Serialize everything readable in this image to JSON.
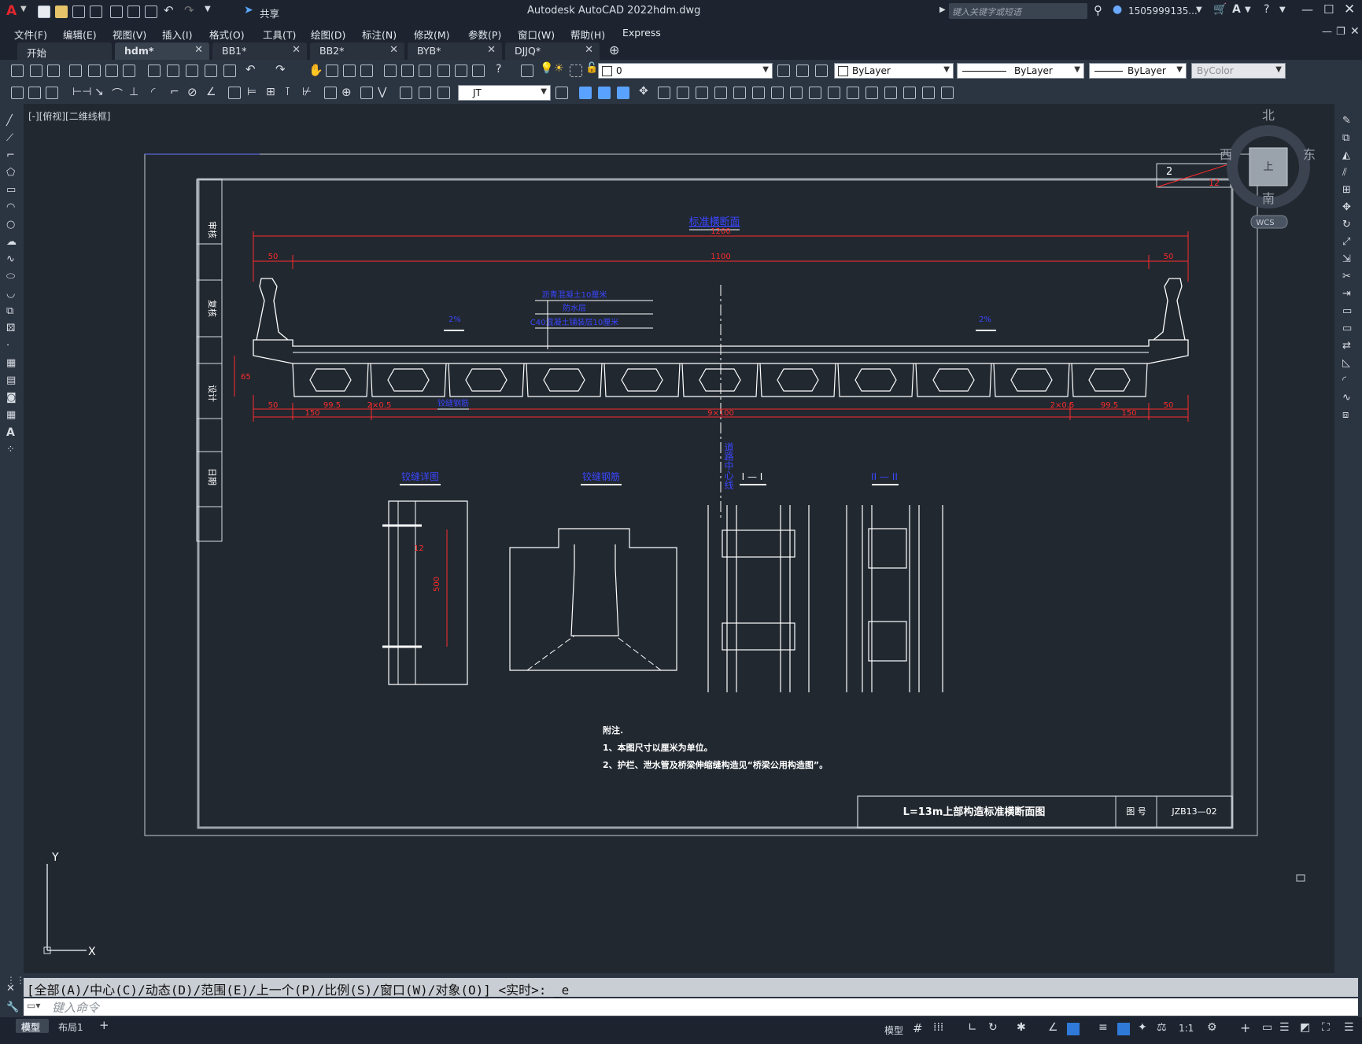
{
  "app": {
    "logo": "A",
    "title": "Autodesk AutoCAD 2022",
    "filename": "hdm.dwg",
    "share_label": "共享",
    "search_placeholder": "键入关键字或短语",
    "user": "1505999135...",
    "window_controls": [
      "minimize-icon",
      "restore-icon",
      "close-icon"
    ]
  },
  "menu": [
    "文件(F)",
    "编辑(E)",
    "视图(V)",
    "插入(I)",
    "格式(O)",
    "工具(T)",
    "绘图(D)",
    "标注(N)",
    "修改(M)",
    "参数(P)",
    "窗口(W)",
    "帮助(H)",
    "Express"
  ],
  "tabs": [
    {
      "label": "开始",
      "active": false
    },
    {
      "label": "hdm*",
      "active": true
    },
    {
      "label": "BB1*",
      "active": false
    },
    {
      "label": "BB2*",
      "active": false
    },
    {
      "label": "BYB*",
      "active": false
    },
    {
      "label": "DJJQ*",
      "active": false
    }
  ],
  "toolbar": {
    "layer_value": "0",
    "color_value": "ByLayer",
    "linetype_value": "ByLayer",
    "lineweight_value": "ByLayer",
    "plotstyle_value": "ByColor",
    "dimstyle_value": "JT"
  },
  "viewport": {
    "label": "[-][俯视][二维线框]",
    "compass": {
      "north": "北",
      "south": "南",
      "east": "东",
      "west": "西",
      "top": "上"
    },
    "wcs": "WCS",
    "ucs_x": "X",
    "ucs_y": "Y"
  },
  "drawing": {
    "title_main": "标准横断面",
    "sheet_no": "2",
    "sheet_total": "12",
    "dim_total": "1200",
    "dim_inner": "1100",
    "dim_left_50": "50",
    "dim_right_50": "50",
    "dim_h": "65",
    "bottom_dims": [
      "50",
      "99.5",
      "2×0.5",
      "9×100",
      "2×0.5",
      "99.5",
      "50",
      "150",
      "150"
    ],
    "layer_notes": [
      "沥青混凝土10厘米",
      "防水层",
      "C40混凝土铺装层10厘米"
    ],
    "slope_left": "2%",
    "slope_right": "2%",
    "bottom_label": "铰缝钢筋",
    "center_label": "道路中心线",
    "detail_titles": [
      "铰缝详图",
      "铰缝钢筋",
      "I — I",
      "II — II"
    ],
    "detail_dims": [
      "12",
      "500"
    ],
    "notes_head": "附注.",
    "notes": [
      "1、本图尺寸以厘米为单位。",
      "2、护栏、泄水管及桥梁伸缩缝构造见“桥梁公用构造图”。"
    ],
    "titleblock_name": "L=13m上部构造标准横断面图",
    "titleblock_fig": "图  号",
    "titleblock_code": "JZB13—02",
    "side_labels": [
      "审核",
      "复核",
      "设计",
      "日期"
    ]
  },
  "command": {
    "history": "[全部(A)/中心(C)/动态(D)/范围(E)/上一个(P)/比例(S)/窗口(W)/对象(O)] <实时>: _e",
    "placeholder": "键入命令"
  },
  "status": {
    "tabs": [
      "模型",
      "布局1"
    ],
    "model_btn": "模型",
    "scale": "1:1"
  }
}
